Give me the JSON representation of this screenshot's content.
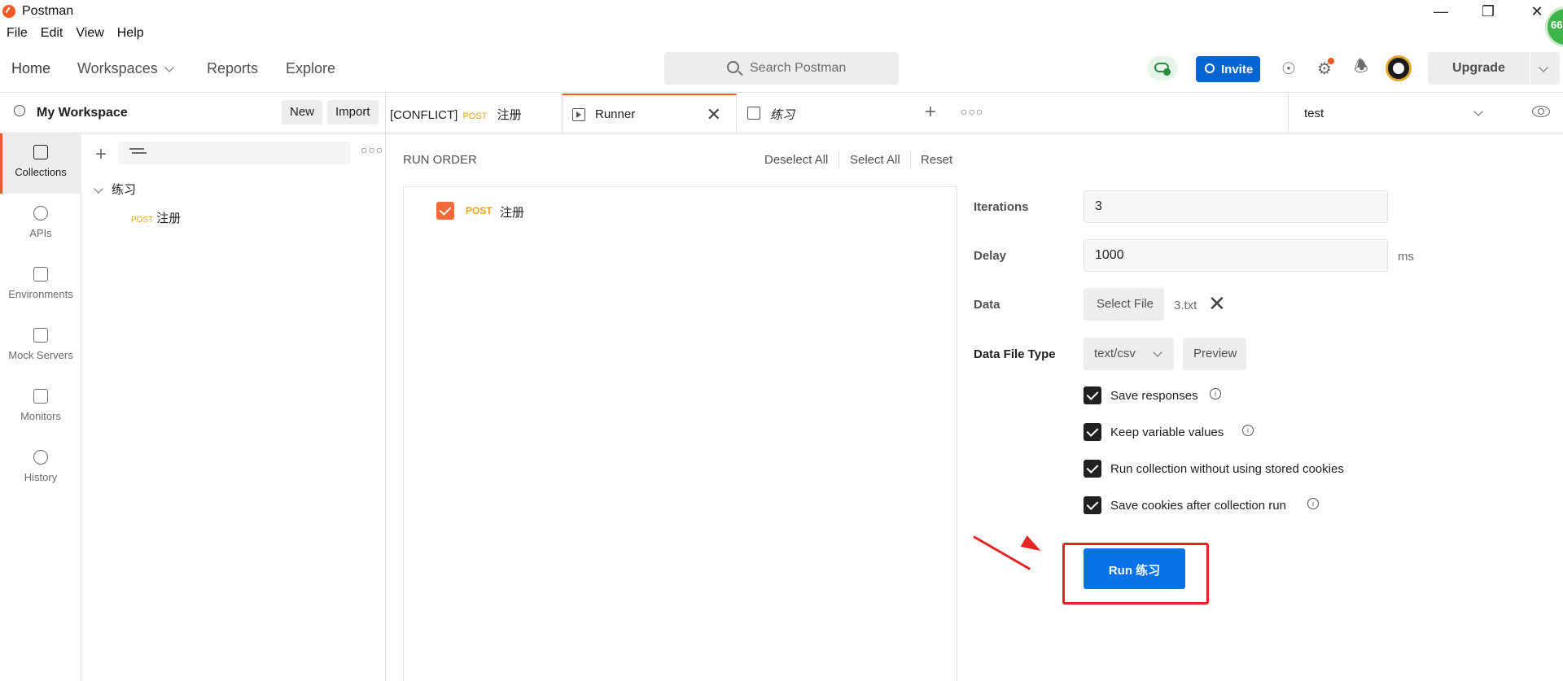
{
  "app": {
    "title": "Postman"
  },
  "menu": [
    "File",
    "Edit",
    "View",
    "Help"
  ],
  "header": {
    "nav": {
      "home": "Home",
      "workspaces": "Workspaces",
      "reports": "Reports",
      "explore": "Explore"
    },
    "search_placeholder": "Search Postman",
    "invite": "Invite",
    "upgrade": "Upgrade",
    "corner_badge": "66"
  },
  "workspace": {
    "title": "My Workspace",
    "new": "New",
    "import": "Import"
  },
  "sidebar": {
    "items": [
      {
        "label": "Collections",
        "icon": "collections-icon"
      },
      {
        "label": "APIs",
        "icon": "apis-icon"
      },
      {
        "label": "Environments",
        "icon": "environments-icon"
      },
      {
        "label": "Mock Servers",
        "icon": "mock-servers-icon"
      },
      {
        "label": "Monitors",
        "icon": "monitors-icon"
      },
      {
        "label": "History",
        "icon": "history-icon"
      }
    ]
  },
  "tree": {
    "folder": "练习",
    "request": {
      "method": "POST",
      "name": "注册"
    }
  },
  "tabs": [
    {
      "prefix": "[CONFLICT]",
      "method": "POST",
      "name": "注册"
    },
    {
      "name": "Runner"
    },
    {
      "name": "练习"
    }
  ],
  "environment": {
    "selected": "test"
  },
  "run_order": {
    "title": "RUN ORDER",
    "deselect_all": "Deselect All",
    "select_all": "Select All",
    "reset": "Reset",
    "items": [
      {
        "method": "POST",
        "name": "注册",
        "checked": true
      }
    ]
  },
  "settings": {
    "iterations_label": "Iterations",
    "iterations_value": "3",
    "delay_label": "Delay",
    "delay_value": "1000",
    "delay_unit": "ms",
    "data_label": "Data",
    "select_file": "Select File",
    "file_name": "3.txt",
    "file_type_label": "Data File Type",
    "file_type_value": "text/csv",
    "preview": "Preview",
    "options": [
      {
        "label": "Save responses",
        "checked": true,
        "info": true
      },
      {
        "label": "Keep variable values",
        "checked": true,
        "info": true
      },
      {
        "label": "Run collection without using stored cookies",
        "checked": true,
        "info": false
      },
      {
        "label": "Save cookies after collection run",
        "checked": true,
        "info": true
      }
    ],
    "run_button": "Run 练习"
  },
  "colors": {
    "accent": "#ef5b25",
    "primary": "#0873e8",
    "annotation": "#e52323"
  }
}
